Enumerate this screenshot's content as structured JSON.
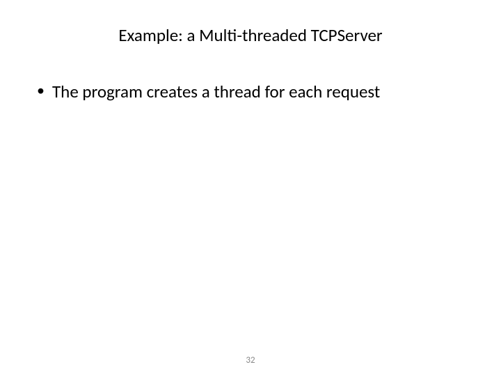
{
  "slide": {
    "title": "Example: a Multi-threaded TCPServer",
    "bullets": [
      "The program creates a thread for each request"
    ],
    "pageNumber": "32"
  }
}
